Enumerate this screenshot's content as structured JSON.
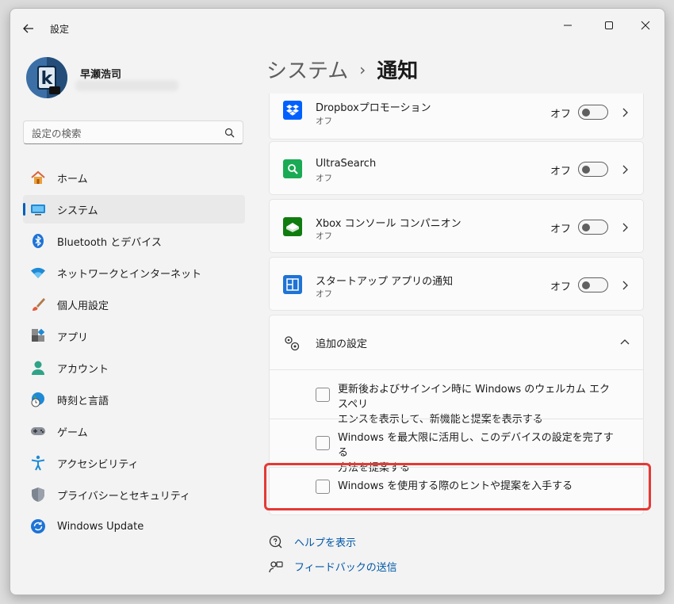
{
  "window": {
    "title": "設定",
    "controls": [
      "minimize-icon",
      "maximize-icon",
      "close-icon"
    ]
  },
  "profile": {
    "name": "早瀬浩司"
  },
  "search": {
    "placeholder": "設定の検索"
  },
  "sidebar": {
    "items": [
      {
        "label": "ホーム",
        "icon": "home-icon"
      },
      {
        "label": "システム",
        "icon": "system-icon",
        "active": true
      },
      {
        "label": "Bluetooth とデバイス",
        "icon": "bluetooth-icon"
      },
      {
        "label": "ネットワークとインターネット",
        "icon": "wifi-icon"
      },
      {
        "label": "個人用設定",
        "icon": "brush-icon"
      },
      {
        "label": "アプリ",
        "icon": "apps-icon"
      },
      {
        "label": "アカウント",
        "icon": "account-icon"
      },
      {
        "label": "時刻と言語",
        "icon": "clock-globe-icon"
      },
      {
        "label": "ゲーム",
        "icon": "gamepad-icon"
      },
      {
        "label": "アクセシビリティ",
        "icon": "accessibility-icon"
      },
      {
        "label": "プライバシーとセキュリティ",
        "icon": "shield-icon"
      },
      {
        "label": "Windows Update",
        "icon": "update-icon"
      }
    ]
  },
  "breadcrumb": {
    "parent": "システム",
    "separator": "›",
    "current": "通知"
  },
  "apps": [
    {
      "name": "Dropboxプロモーション",
      "status": "オフ",
      "toggle": "オフ",
      "icon": "dropbox-icon"
    },
    {
      "name": "UltraSearch",
      "status": "オフ",
      "toggle": "オフ",
      "icon": "ultrasearch-icon"
    },
    {
      "name": "Xbox コンソール コンパニオン",
      "status": "オフ",
      "toggle": "オフ",
      "icon": "xbox-icon"
    },
    {
      "name": "スタートアップ アプリの通知",
      "status": "オフ",
      "toggle": "オフ",
      "icon": "startup-apps-icon"
    }
  ],
  "additional": {
    "title": "追加の設定",
    "options": [
      {
        "line1": "更新後およびサインイン時に Windows のウェルカム エクスペリ",
        "line2": "エンスを表示して、新機能と提案を表示する",
        "checked": false
      },
      {
        "line1": "Windows を最大限に活用し、このデバイスの設定を完了する",
        "line2": "方法を提案する",
        "checked": false
      },
      {
        "line1": "Windows を使用する際のヒントや提案を入手する",
        "line2": "",
        "checked": false
      }
    ]
  },
  "links": {
    "help": "ヘルプを表示",
    "feedback": "フィードバックの送信"
  },
  "colors": {
    "accent": "#005fb8",
    "highlight": "#e53935",
    "link": "#0058a8"
  }
}
